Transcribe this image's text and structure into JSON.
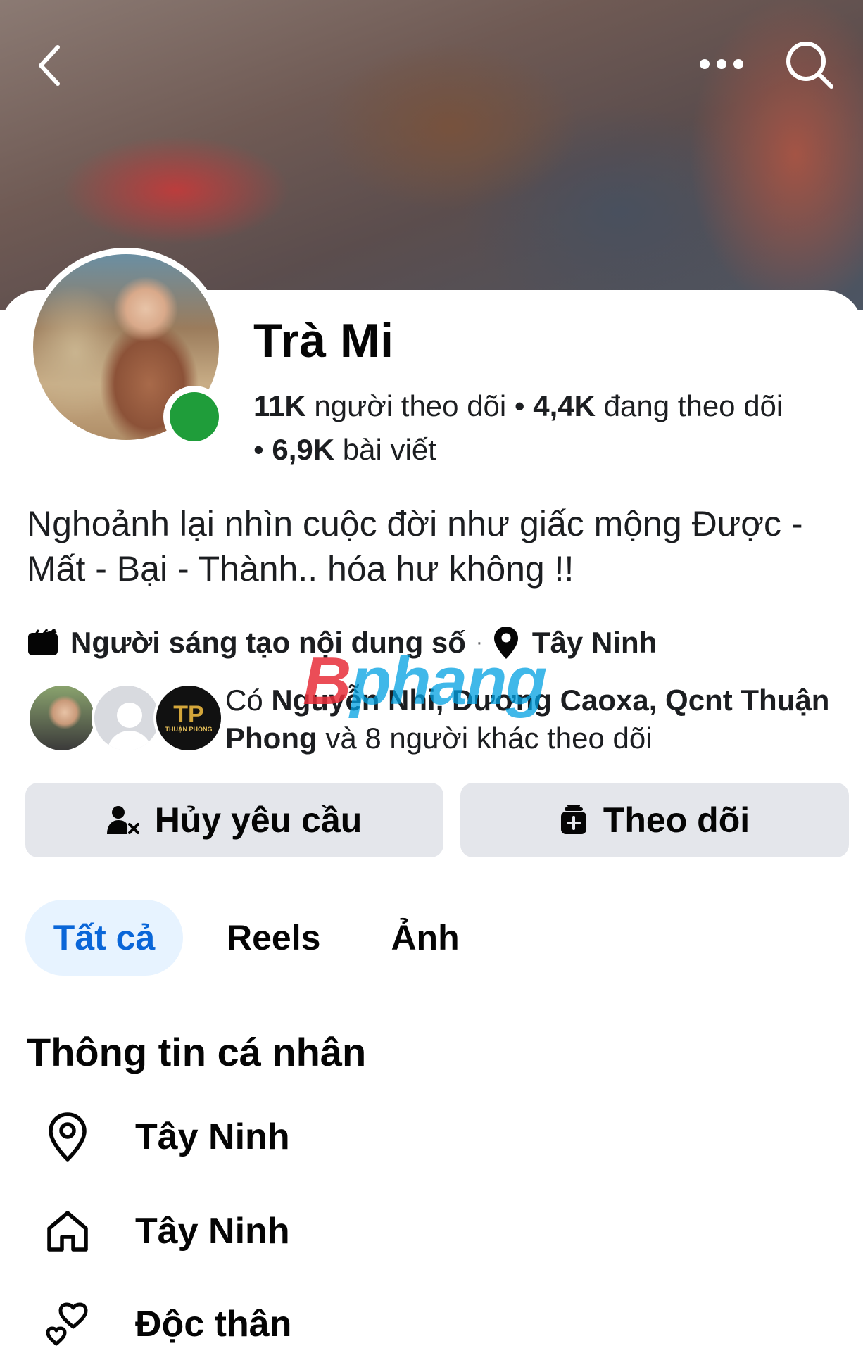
{
  "header": {
    "back_icon": "chevron-left-icon",
    "more_icon": "more-horizontal-icon",
    "search_icon": "search-icon"
  },
  "profile": {
    "name": "Trà Mi",
    "followers_count": "11K",
    "followers_label": "người theo dõi",
    "following_count": "4,4K",
    "following_label": "đang theo dõi",
    "posts_count": "6,9K",
    "posts_label": "bài viết",
    "online": true,
    "online_color": "#1f9d3a"
  },
  "bio": "Nghoảnh lại nhìn cuộc đời như giấc mộng Được - Mất - Bại - Thành.. hóa hư không !!",
  "meta": {
    "creator_label": "Người sáng tạo nội dung số",
    "separator": "·",
    "location": "Tây Ninh"
  },
  "mutuals": {
    "prefix": "Có",
    "names": "Nguyễn Nhi, Dương Caoxa, Qcnt Thuận Phong",
    "suffix": "và 8 người khác theo dõi",
    "avatar3_initials": "TP",
    "avatar3_caption": "THUẬN PHONG"
  },
  "watermark": {
    "first": "B",
    "rest": "phang"
  },
  "actions": {
    "cancel_request_label": "Hủy yêu cầu",
    "follow_label": "Theo dõi"
  },
  "tabs": [
    {
      "label": "Tất cả",
      "active": true
    },
    {
      "label": "Reels",
      "active": false
    },
    {
      "label": "Ảnh",
      "active": false
    }
  ],
  "about": {
    "title": "Thông tin cá nhân",
    "items": [
      {
        "icon": "location-pin-icon",
        "text": "Tây Ninh"
      },
      {
        "icon": "home-icon",
        "text": "Tây Ninh"
      },
      {
        "icon": "relationship-hearts-icon",
        "text": "Độc thân"
      }
    ]
  },
  "colors": {
    "accent": "#0a66d8",
    "accent_bg": "#e7f3ff",
    "button_bg": "#e4e6eb"
  }
}
